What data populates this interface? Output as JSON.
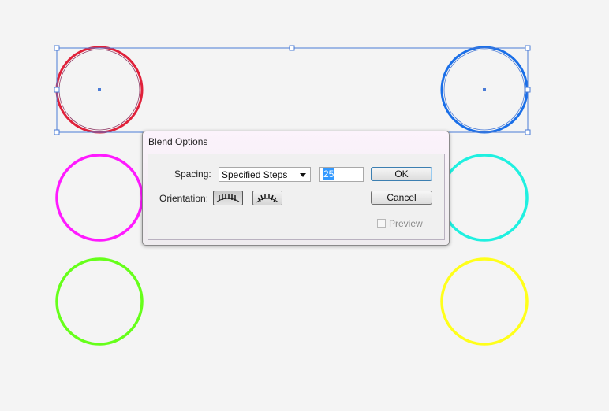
{
  "artboard": {
    "background": "#f4f4f4",
    "selection_color": "#4a7bd6",
    "circles": [
      {
        "name": "red",
        "color": "#e0213a"
      },
      {
        "name": "blue",
        "color": "#1a6fe8"
      },
      {
        "name": "magenta",
        "color": "#ff1aff"
      },
      {
        "name": "cyan",
        "color": "#1ff0e0"
      },
      {
        "name": "green",
        "color": "#66ff1a"
      },
      {
        "name": "yellow",
        "color": "#ffff1a"
      }
    ]
  },
  "dialog": {
    "title": "Blend Options",
    "spacing_label": "Spacing:",
    "spacing_value": "Specified Steps",
    "steps_value": "25",
    "orientation_label": "Orientation:",
    "orientation_options": [
      "align-to-page-icon",
      "align-to-path-icon"
    ],
    "orientation_selected": "align-to-page-icon",
    "ok_label": "OK",
    "cancel_label": "Cancel",
    "preview_label": "Preview",
    "preview_checked": false
  }
}
